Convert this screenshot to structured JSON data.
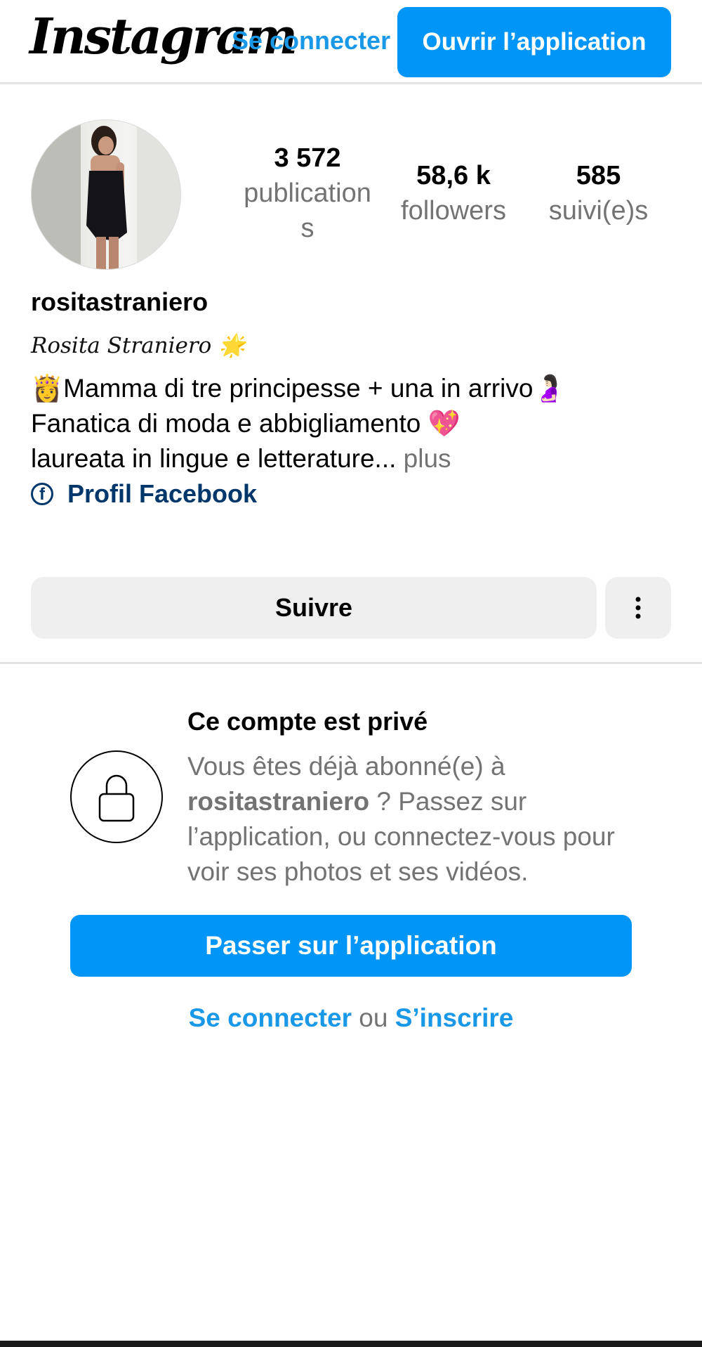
{
  "header": {
    "logo_text": "Instagram",
    "login_label": "Se connecter",
    "open_app_label": "Ouvrir l’application"
  },
  "profile": {
    "stats": {
      "posts_count": "3 572",
      "posts_label": "publications",
      "followers_count": "58,6 k",
      "followers_label": "followers",
      "following_count": "585",
      "following_label": "suivi(e)s"
    },
    "username": "rositastraniero",
    "full_name": "Rosita Straniero",
    "full_name_emoji": "🌟",
    "bio": {
      "line1": "👸Mamma di tre principesse + una in arrivo🤰🏻",
      "line2": "Fanatica di moda e abbigliamento 💖",
      "line3": "laureata in lingue e letterature...",
      "more_label": " plus"
    },
    "link_label": "Profil Facebook",
    "facebook_icon_glyph": "f",
    "follow_label": "Suivre",
    "more_icon": "more-vertical-icon"
  },
  "private_notice": {
    "title": "Ce compte est privé",
    "text_before": "Vous êtes déjà abonné(e) à ",
    "username": "rositastraniero",
    "text_after": " ? Passez sur l’application, ou connectez-vous pour voir ses photos et ses vidéos.",
    "lock_icon": "lock-icon",
    "switch_app_label": "Passer sur l’application",
    "login_label": "Se connecter",
    "or_label": " ou ",
    "signup_label": "S’inscrire"
  },
  "colors": {
    "brand_blue": "#0095f6",
    "link_blue": "#1a98e8",
    "facebook_link": "#00376b",
    "muted_text": "#737373",
    "button_gray": "#efefef"
  }
}
